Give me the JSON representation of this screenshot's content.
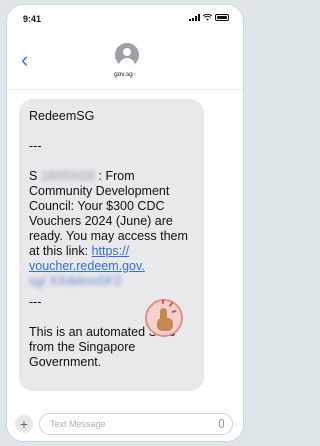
{
  "status_bar": {
    "time": "9:41"
  },
  "header": {
    "sender": "gov.sg",
    "chevron": "›"
  },
  "message": {
    "title": "RedeemSG",
    "sep1": "---",
    "line_s": "S",
    "blurred_id": "18X5XG0",
    "body_main": ": From Community Development Council: Your $300 CDC Vouchers 2024 (June) are ready. You may access them at this link:",
    "link_visible": "https:// voucher.redeem.gov.",
    "link_blurred": "sg/ XXdekm/0F2",
    "sep2": "---",
    "footer": "This is an automated SMS from the Singapore Government."
  },
  "composer": {
    "placeholder": "Text Message",
    "plus": "+"
  },
  "colors": {
    "accent": "#2f7cf6",
    "bubble": "#e9e9eb",
    "link": "#2f6fe0",
    "tap_highlight": "#e48f88"
  }
}
